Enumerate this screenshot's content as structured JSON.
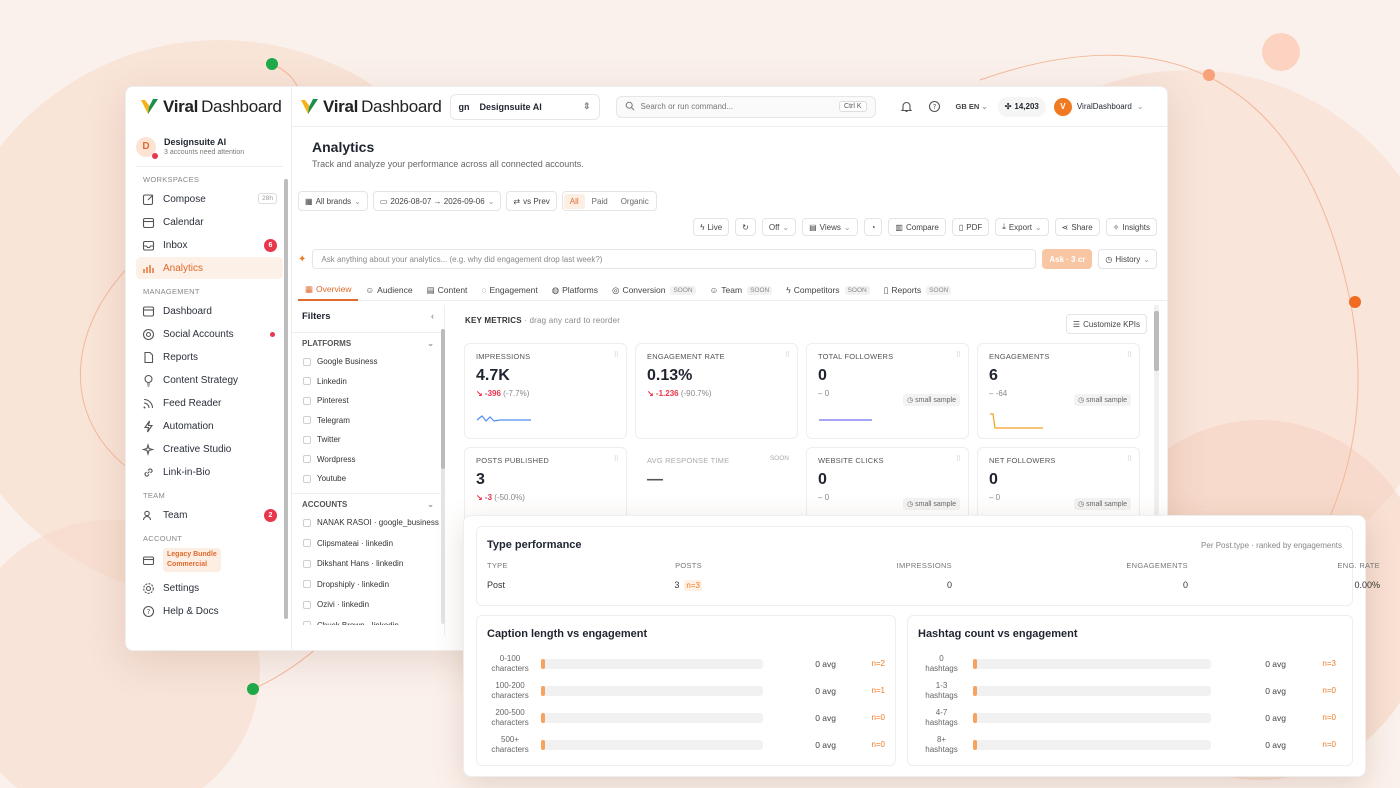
{
  "brand": {
    "name_a": "Viral",
    "name_b": "Dashboard",
    "accent": "#e06a2c",
    "danger": "#e8364d"
  },
  "sidebar": {
    "workspace": {
      "initial": "D",
      "name": "Designsuite AI",
      "note": "3 accounts need attention"
    },
    "sections": {
      "workspaces": "WORKSPACES",
      "management": "MANAGEMENT",
      "team": "TEAM",
      "account": "ACCOUNT"
    },
    "items": {
      "compose": {
        "label": "Compose",
        "kbd": "28h"
      },
      "calendar": {
        "label": "Calendar"
      },
      "inbox": {
        "label": "Inbox",
        "badge": "6"
      },
      "analytics": {
        "label": "Analytics"
      },
      "dashboard": {
        "label": "Dashboard"
      },
      "social": {
        "label": "Social Accounts"
      },
      "reports": {
        "label": "Reports"
      },
      "strategy": {
        "label": "Content Strategy"
      },
      "feed": {
        "label": "Feed Reader"
      },
      "automation": {
        "label": "Automation"
      },
      "creative": {
        "label": "Creative Studio"
      },
      "linkbio": {
        "label": "Link-in-Bio"
      },
      "team": {
        "label": "Team",
        "badge": "2"
      },
      "legacy_1": "Legacy Bundle",
      "legacy_2": "Commercial",
      "settings": {
        "label": "Settings"
      },
      "help": {
        "label": "Help & Docs"
      }
    }
  },
  "topbar": {
    "workspace_prefix": "gn",
    "workspace_label": "Designsuite AI",
    "search_placeholder": "Search or run command...",
    "search_kbd": "Ctrl K",
    "lang": "GB EN",
    "credits": "14,203",
    "user_initial": "V",
    "user_name": "ViralDashboard"
  },
  "page": {
    "title": "Analytics",
    "subtitle": "Track and analyze your performance across all connected accounts."
  },
  "toolbar": {
    "brands": "All brands",
    "date_range": "2026-08-07 → 2026-09-06",
    "compare": "vs Prev",
    "seg_all": "All",
    "seg_paid": "Paid",
    "seg_organic": "Organic",
    "live": "Live",
    "off": "Off",
    "views": "Views",
    "compare_btn": "Compare",
    "pdf": "PDF",
    "export": "Export",
    "share": "Share",
    "insights": "Insights"
  },
  "ask": {
    "placeholder": "Ask anything about your analytics... (e.g. why did engagement drop last week?)",
    "button": "Ask · 3 cr",
    "history": "History"
  },
  "tabs": {
    "overview": "Overview",
    "audience": "Audience",
    "content": "Content",
    "engagement": "Engagement",
    "platforms": "Platforms",
    "conversion": "Conversion",
    "team": "Team",
    "competitors": "Competitors",
    "reports": "Reports",
    "soon": "SOON"
  },
  "filters": {
    "title": "Filters",
    "platforms_title": "PLATFORMS",
    "platforms": [
      "Google Business",
      "Linkedin",
      "Pinterest",
      "Telegram",
      "Twitter",
      "Wordpress",
      "Youtube"
    ],
    "accounts_title": "ACCOUNTS",
    "accounts": [
      "NANAK RASOI · google_business",
      "Clipsmateai · linkedin",
      "Dikshant Hans · linkedin",
      "Dropshiply · linkedin",
      "Ozivi · linkedin",
      "Chuck Brown · linkedin"
    ]
  },
  "metrics": {
    "heading": "KEY METRICS",
    "hint": "· drag any card to reorder",
    "customize": "Customize KPIs",
    "small_sample": "small sample",
    "cards": {
      "impressions": {
        "title": "IMPRESSIONS",
        "value": "4.7K",
        "delta": "↘ -396",
        "pct": "(-7.7%)"
      },
      "engrate": {
        "title": "ENGAGEMENT RATE",
        "value": "0.13%",
        "delta": "↘ -1.236",
        "pct": "(-90.7%)"
      },
      "followers": {
        "title": "TOTAL FOLLOWERS",
        "value": "0",
        "delta": "– 0"
      },
      "engagements": {
        "title": "ENGAGEMENTS",
        "value": "6",
        "delta": "– -64"
      },
      "posts": {
        "title": "POSTS PUBLISHED",
        "value": "3",
        "delta": "↘ -3",
        "pct": "(-50.0%)"
      },
      "response": {
        "title": "AVG RESPONSE TIME",
        "value": "—",
        "soon": "SOON"
      },
      "clicks": {
        "title": "WEBSITE CLICKS",
        "value": "0",
        "delta": "– 0"
      },
      "netfollowers": {
        "title": "NET FOLLOWERS",
        "value": "0",
        "delta": "– 0"
      }
    }
  },
  "type_perf": {
    "title": "Type performance",
    "note": "Per Post.type · ranked by engagements",
    "headers": [
      "TYPE",
      "POSTS",
      "IMPRESSIONS",
      "ENGAGEMENTS",
      "ENG. RATE"
    ],
    "row": {
      "type": "Post",
      "posts": "3",
      "n": "n=3",
      "impressions": "0",
      "engagements": "0",
      "rate": "0.00%"
    }
  },
  "caption": {
    "title": "Caption length vs engagement",
    "rows": [
      {
        "l1": "0-100",
        "l2": "characters",
        "avg": "0 avg",
        "n": "n=2"
      },
      {
        "l1": "100-200",
        "l2": "characters",
        "avg": "0 avg",
        "n": "n=1"
      },
      {
        "l1": "200-500",
        "l2": "characters",
        "avg": "0 avg",
        "n": "n=0"
      },
      {
        "l1": "500+",
        "l2": "characters",
        "avg": "0 avg",
        "n": "n=0"
      }
    ]
  },
  "hashtag": {
    "title": "Hashtag count vs engagement",
    "rows": [
      {
        "l1": "0",
        "l2": "hashtags",
        "avg": "0 avg",
        "n": "n=3"
      },
      {
        "l1": "1-3",
        "l2": "hashtags",
        "avg": "0 avg",
        "n": "n=0"
      },
      {
        "l1": "4-7",
        "l2": "hashtags",
        "avg": "0 avg",
        "n": "n=0"
      },
      {
        "l1": "8+",
        "l2": "hashtags",
        "avg": "0 avg",
        "n": "n=0"
      }
    ]
  }
}
